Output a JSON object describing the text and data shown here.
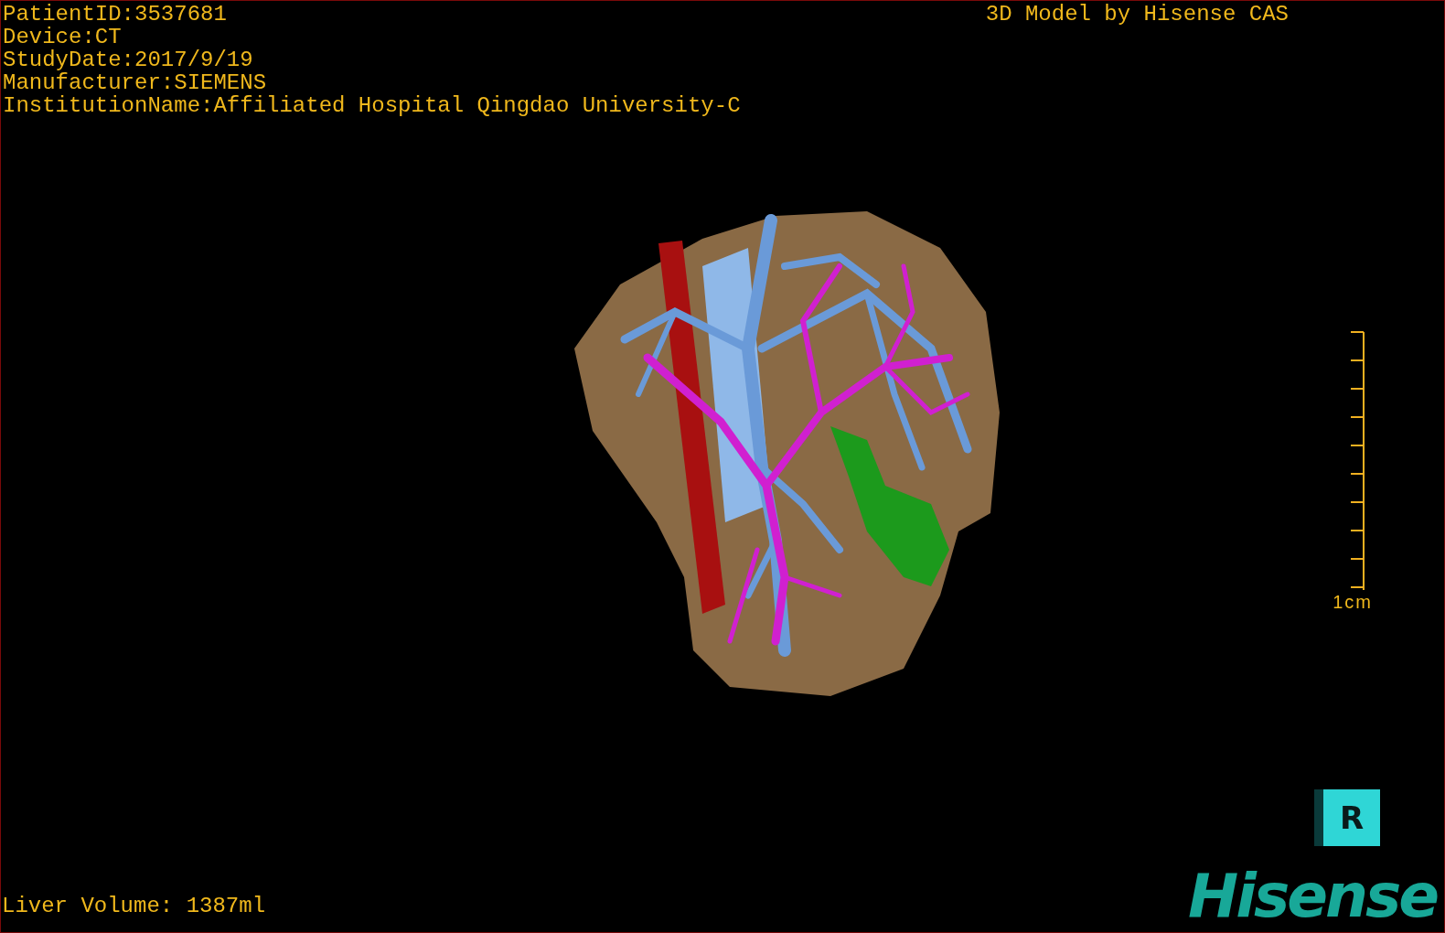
{
  "header": {
    "info_lines": [
      "PatientID:3537681",
      "Device:CT",
      "StudyDate:2017/9/19",
      "Manufacturer:SIEMENS",
      "InstitutionName:Affiliated Hospital Qingdao University-C"
    ],
    "title": "3D Model by Hisense CAS"
  },
  "scale_bar": {
    "label": "1cm"
  },
  "liver_volume": "Liver Volume: 1387ml",
  "orientation_cube": {
    "label": "R"
  },
  "logo": {
    "text": "Hisense"
  }
}
